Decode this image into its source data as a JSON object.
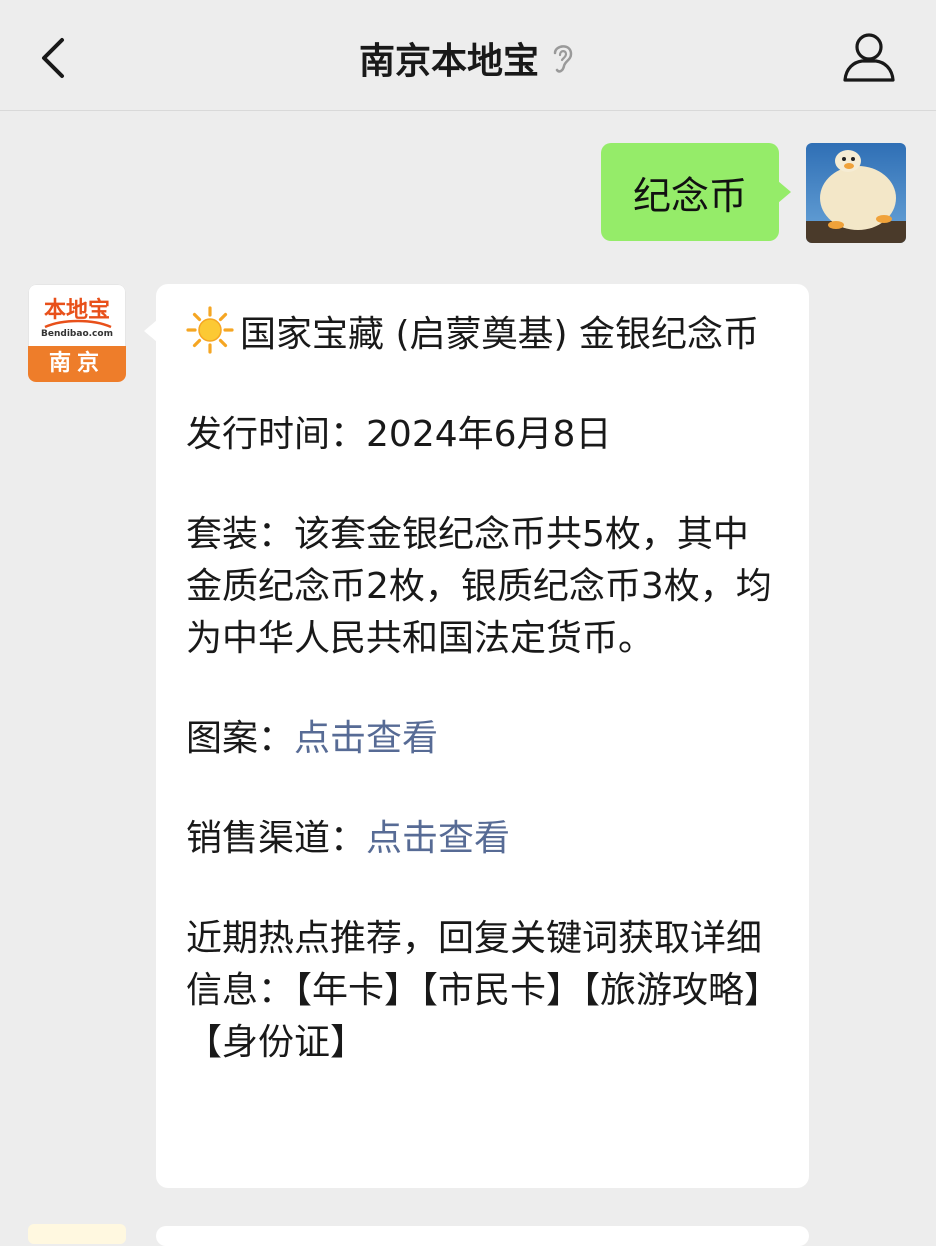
{
  "header": {
    "title": "南京本地宝"
  },
  "user_message": {
    "text": "纪念币"
  },
  "bot_avatar": {
    "brand": "本地宝",
    "domain": "Bendibao.com",
    "city": "南京"
  },
  "bot_message": {
    "title": "国家宝藏 (启蒙奠基) 金银纪念币",
    "issue_label": "发行时间：",
    "issue_date": "2024年6月8日",
    "set_label": "套装：",
    "set_text": "该套金银纪念币共5枚，其中金质纪念币2枚，银质纪念币3枚，均为中华人民共和国法定货币。",
    "pattern_label": "图案：",
    "pattern_link": "点击查看",
    "sales_label": "销售渠道：",
    "sales_link": "点击查看",
    "recommend_text": "近期热点推荐，回复关键词获取详细信息：",
    "keywords": "【年卡】【市民卡】【旅游攻略】【身份证】"
  },
  "colors": {
    "background": "#ededed",
    "outgoing_bubble": "#95ec69",
    "incoming_bubble": "#ffffff",
    "link": "#576b95",
    "brand_orange": "#ee7d2a"
  }
}
